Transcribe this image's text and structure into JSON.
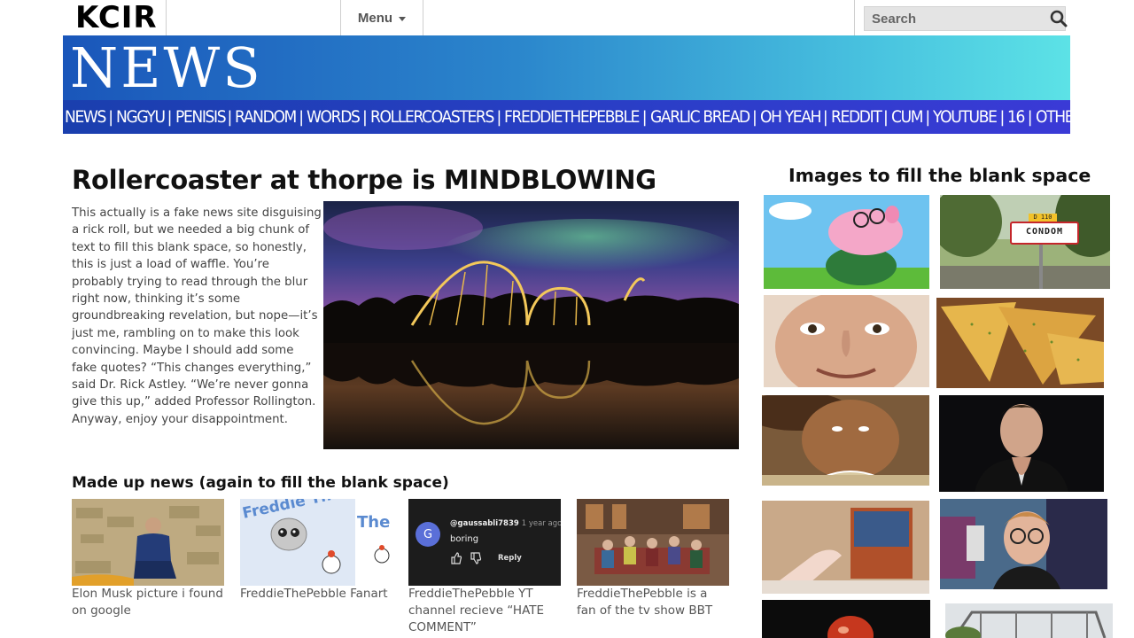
{
  "header": {
    "logo": "KCIR",
    "menu_label": "Menu",
    "search_placeholder": "Search"
  },
  "banner": {
    "title": "NEWS"
  },
  "nav": {
    "items": [
      "NEWS",
      "NGGYU",
      "PENISIS",
      "RANDOM",
      "WORDS",
      "ROLLERCOASTERS",
      "FREDDIETHEPEBBLE",
      "GARLIC BREAD",
      "OH YEAH",
      "REDDIT",
      "CUM",
      "YOUTUBE",
      "16",
      "OTHER >"
    ]
  },
  "article": {
    "headline": "Rollercoaster at thorpe is MINDBLOWING",
    "body": "This actually is a fake news site disguising a rick roll, but we needed a big chunk of text to fill this blank space, so honestly, this is just a load of waffle. You’re probably trying to read through the blur right now, thinking it’s some groundbreaking revelation, but nope—it’s just me, rambling on to make this look convincing. Maybe I should add some fake quotes? “This changes everything,” said Dr. Rick Astley. “We’re never gonna give this up,” added Professor Rollington. Anyway, enjoy your disappointment."
  },
  "made_up_news": {
    "title": "Made up news (again to fill the blank space)",
    "cards": [
      {
        "caption": "Elon Musk picture i found on google"
      },
      {
        "caption": "FreddieThePebble Fanart",
        "thumb_text": "Freddie The Pebble!",
        "thumb_text2": "The"
      },
      {
        "caption": "FreddieThePebble YT channel recieve “HATE COMMENT”",
        "comment_user": "@gaussabli7839",
        "comment_time": "1 year ago",
        "comment_text": "boring",
        "reply": "Reply",
        "avatar_letter": "G"
      },
      {
        "caption": "FreddieThePebble is a fan of the tv show BBT"
      }
    ]
  },
  "side_panel": {
    "title": "Images to fill the blank space",
    "sign_text": "CONDOM",
    "sign_code": "D 110"
  }
}
